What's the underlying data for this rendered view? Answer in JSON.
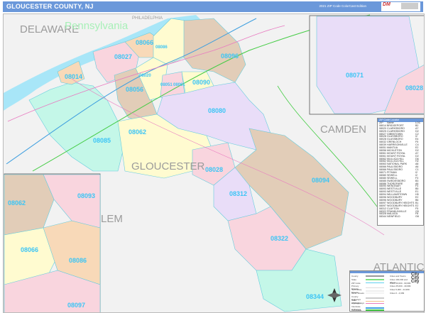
{
  "header": {
    "title": "GLOUCESTER COUNTY, NJ",
    "edition": "2021 ZIP Code ColorCast Edition",
    "logo_text": "Digital Maps",
    "accent_color": "#6b98da"
  },
  "places": {
    "delaware": "DELAWARE",
    "pennsylvania": "Pennsylvania",
    "philadelphia": "PHILADELPHIA",
    "camden": "CAMDEN",
    "gloucester": "GLOUCESTER",
    "salem": "LEM",
    "atlantic": "ATLANTIC"
  },
  "zip_labels": {
    "z08066": "08066",
    "z08086": "08086",
    "z08027": "08027",
    "z08014": "08014",
    "z08020": "08020",
    "z08051": "08051",
    "z08061": "08061",
    "z08090": "08090",
    "z08096": "08096",
    "z08056": "08056",
    "z08080": "08080",
    "z08062": "08062",
    "z08085": "08085",
    "z08028": "08028",
    "z08094": "08094",
    "z08312": "08312",
    "z08322": "08322",
    "z08344": "08344",
    "inset_08071": "08071",
    "inset_08028": "08028",
    "inset_08093": "08093",
    "inset_08062": "08062",
    "inset_08066": "08066",
    "inset_08086": "08086",
    "inset_08097": "08097"
  },
  "zip_table": {
    "title": "ZIP Code Locator",
    "headers": [
      "ZIP",
      "Name",
      "LOC"
    ],
    "rows": [
      [
        "08014",
        "BRIDGEPORT",
        "B2"
      ],
      [
        "08020",
        "CLARKSBORO",
        "A7"
      ],
      [
        "08025",
        "CLARKSBORO",
        "D2"
      ],
      [
        "08027",
        "GIBBSTOWN",
        "C2"
      ],
      [
        "08028",
        "GLASSBORO",
        "I2"
      ],
      [
        "08028",
        "GLASSBORO",
        "E4"
      ],
      [
        "08032",
        "GRENLOCH",
        "F5"
      ],
      [
        "08039",
        "HARRISONVILLE",
        "C4"
      ],
      [
        "08051",
        "MANTUA",
        "E2"
      ],
      [
        "08056",
        "MICKLETON",
        "D2"
      ],
      [
        "08061",
        "MOUNT ROYAL",
        "A7"
      ],
      [
        "08061",
        "MOUNT ROYAL",
        "D2"
      ],
      [
        "08062",
        "MULLICA HILL",
        "D6"
      ],
      [
        "08062",
        "MULLICA HILL",
        "H2"
      ],
      [
        "08063",
        "NATIONAL PARK",
        "A8"
      ],
      [
        "08066",
        "PAULSBORO",
        "A6"
      ],
      [
        "08066",
        "PAULSBORO",
        "C1"
      ],
      [
        "08071",
        "PITMAN",
        "I2"
      ],
      [
        "08080",
        "SEWELL",
        "I2"
      ],
      [
        "08080",
        "SEWELL",
        "F3"
      ],
      [
        "08085",
        "SWEDESBORO",
        "B3"
      ],
      [
        "08086",
        "THOROFARE",
        "A6"
      ],
      [
        "08090",
        "WENONAH",
        "F4"
      ],
      [
        "08093",
        "WESTVILLE",
        "B5"
      ],
      [
        "08093",
        "WESTVILLE",
        "E1"
      ],
      [
        "08094",
        "WILLIAMSTOWN",
        "H5"
      ],
      [
        "08096",
        "WOODBURY",
        "E2"
      ],
      [
        "08096",
        "WOODBURY",
        "B6"
      ],
      [
        "08097",
        "WOODBURY HEIGHTS",
        "B1"
      ],
      [
        "08097",
        "WOODBURY HEIGHTS",
        "E2"
      ],
      [
        "08312",
        "CLAYTON",
        "F5"
      ],
      [
        "08322",
        "FRANKLINVILLE",
        "G5"
      ],
      [
        "08328",
        "MALAGA",
        "F8"
      ],
      [
        "08344",
        "NEWFIELD",
        "G8"
      ]
    ]
  },
  "legend": {
    "items": [
      {
        "label": "County",
        "color": "#999999"
      },
      {
        "label": "State",
        "color": "#7fe07f"
      },
      {
        "label": "ZIP Code",
        "color": "#5fd0f0"
      },
      {
        "label": "Primary Streets",
        "color": "#dddddd"
      },
      {
        "label": "Secondary Streets",
        "color": "#eeeeee"
      },
      {
        "label": "Minor Streets",
        "color": "#f4f4f4"
      },
      {
        "label": "County Highways",
        "color": "#cccccc"
      },
      {
        "label": "State Highways",
        "color": "#f2c28a"
      },
      {
        "label": "US Highways",
        "color": "#e87ac0"
      },
      {
        "label": "Interstate Highways",
        "color": "#3f9fdf"
      },
      {
        "label": "Toll Roads",
        "color": "#44cc44"
      }
    ],
    "cities": [
      "Cities and Towns",
      "Cities 100,000 and above",
      "Cities 50,000 - 99,999",
      "Cities 25,000 - 49,999",
      "Cities 5,000 - 24,999",
      "Cities 0 - 4,999"
    ],
    "city_icon": "City City City"
  }
}
